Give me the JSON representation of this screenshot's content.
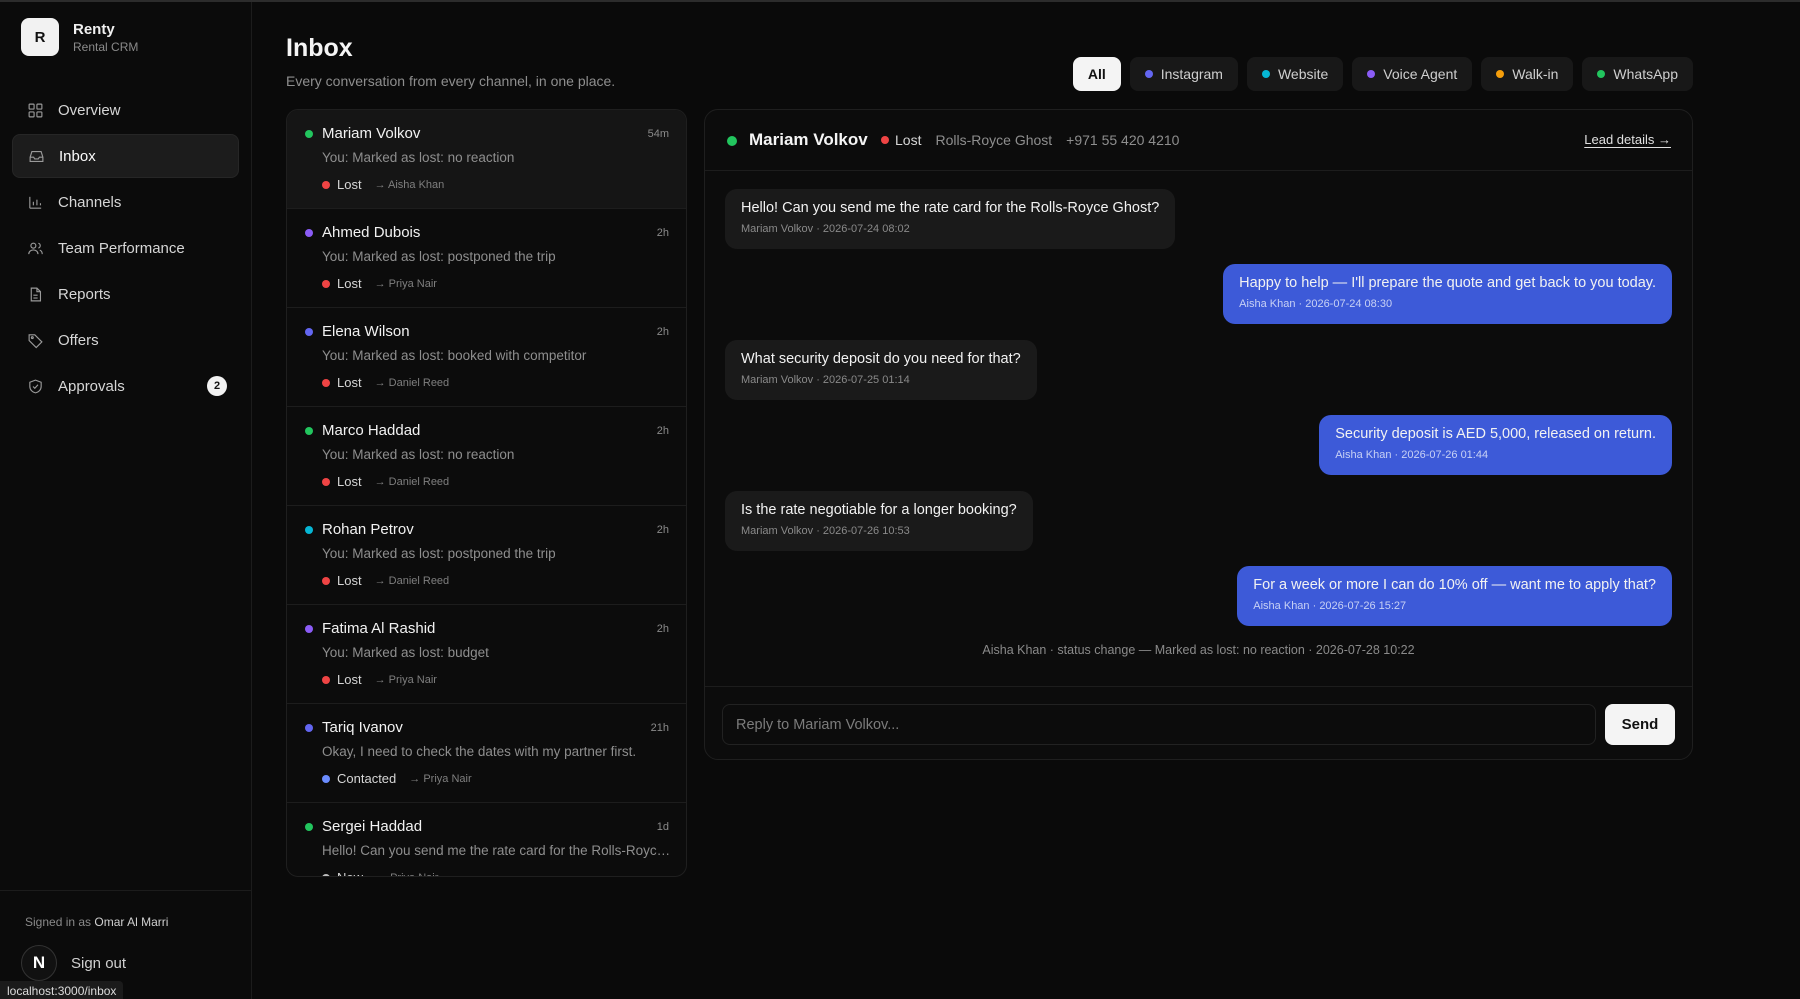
{
  "brand": {
    "logo": "R",
    "name": "Renty",
    "subtitle": "Rental CRM"
  },
  "nav": [
    {
      "label": "Overview",
      "icon": "grid-icon",
      "active": false
    },
    {
      "label": "Inbox",
      "icon": "inbox-icon",
      "active": true
    },
    {
      "label": "Channels",
      "icon": "bar-chart-icon",
      "active": false
    },
    {
      "label": "Team Performance",
      "icon": "users-icon",
      "active": false
    },
    {
      "label": "Reports",
      "icon": "document-icon",
      "active": false
    },
    {
      "label": "Offers",
      "icon": "tag-icon",
      "active": false
    },
    {
      "label": "Approvals",
      "icon": "shield-check-icon",
      "active": false,
      "badge": "2"
    }
  ],
  "footer": {
    "signed_prefix": "Signed in as",
    "user": "Omar Al Marri",
    "avatar": "N",
    "signout": "Sign out",
    "url": "localhost:3000/inbox"
  },
  "header": {
    "title": "Inbox",
    "subtitle": "Every conversation from every channel, in one place."
  },
  "filters": [
    {
      "label": "All",
      "color": null,
      "active": true
    },
    {
      "label": "Instagram",
      "color": "#6366f1",
      "active": false
    },
    {
      "label": "Website",
      "color": "#06b6d4",
      "active": false
    },
    {
      "label": "Voice Agent",
      "color": "#8b5cf6",
      "active": false
    },
    {
      "label": "Walk-in",
      "color": "#f59e0b",
      "active": false
    },
    {
      "label": "WhatsApp",
      "color": "#22c55e",
      "active": false
    }
  ],
  "status_colors": {
    "Lost": "#ef4444",
    "Contacted": "#6b8cff",
    "New": "#bdbdbd"
  },
  "conversations": [
    {
      "name": "Mariam Volkov",
      "time": "54m",
      "message": "You: Marked as lost: no reaction",
      "status": "Lost",
      "assignee": "→ Aisha Khan",
      "channel_color": "#22c55e",
      "active": true
    },
    {
      "name": "Ahmed Dubois",
      "time": "2h",
      "message": "You: Marked as lost: postponed the trip",
      "status": "Lost",
      "assignee": "→ Priya Nair",
      "channel_color": "#8b5cf6",
      "active": false
    },
    {
      "name": "Elena Wilson",
      "time": "2h",
      "message": "You: Marked as lost: booked with competitor",
      "status": "Lost",
      "assignee": "→ Daniel Reed",
      "channel_color": "#6366f1",
      "active": false
    },
    {
      "name": "Marco Haddad",
      "time": "2h",
      "message": "You: Marked as lost: no reaction",
      "status": "Lost",
      "assignee": "→ Daniel Reed",
      "channel_color": "#22c55e",
      "active": false
    },
    {
      "name": "Rohan Petrov",
      "time": "2h",
      "message": "You: Marked as lost: postponed the trip",
      "status": "Lost",
      "assignee": "→ Daniel Reed",
      "channel_color": "#06b6d4",
      "active": false
    },
    {
      "name": "Fatima Al Rashid",
      "time": "2h",
      "message": "You: Marked as lost: budget",
      "status": "Lost",
      "assignee": "→ Priya Nair",
      "channel_color": "#8b5cf6",
      "active": false
    },
    {
      "name": "Tariq Ivanov",
      "time": "21h",
      "message": "Okay, I need to check the dates with my partner first.",
      "status": "Contacted",
      "assignee": "→ Priya Nair",
      "channel_color": "#6366f1",
      "active": false
    },
    {
      "name": "Sergei Haddad",
      "time": "1d",
      "message": "Hello! Can you send me the rate card for the Rolls-Royce Ghost?",
      "status": "New",
      "assignee": "→ Priya Nair",
      "channel_color": "#22c55e",
      "active": false
    }
  ],
  "chat": {
    "name": "Mariam Volkov",
    "channel_color": "#22c55e",
    "status": "Lost",
    "vehicle": "Rolls-Royce Ghost",
    "phone": "+971 55 420 4210",
    "lead_link": "Lead details →",
    "messages": [
      {
        "direction": "in",
        "text": "Hello! Can you send me the rate card for the Rolls-Royce Ghost?",
        "meta": "Mariam Volkov · 2026-07-24 08:02"
      },
      {
        "direction": "out",
        "text": "Happy to help — I'll prepare the quote and get back to you today.",
        "meta": "Aisha Khan · 2026-07-24 08:30"
      },
      {
        "direction": "in",
        "text": "What security deposit do you need for that?",
        "meta": "Mariam Volkov · 2026-07-25 01:14"
      },
      {
        "direction": "out",
        "text": "Security deposit is AED 5,000, released on return.",
        "meta": "Aisha Khan · 2026-07-26 01:44"
      },
      {
        "direction": "in",
        "text": "Is the rate negotiable for a longer booking?",
        "meta": "Mariam Volkov · 2026-07-26 10:53"
      },
      {
        "direction": "out",
        "text": "For a week or more I can do 10% off — want me to apply that?",
        "meta": "Aisha Khan · 2026-07-26 15:27"
      }
    ],
    "system_note": "Aisha Khan · status change — Marked as lost: no reaction · 2026-07-28 10:22",
    "reply_placeholder": "Reply to Mariam Volkov...",
    "send_label": "Send"
  }
}
